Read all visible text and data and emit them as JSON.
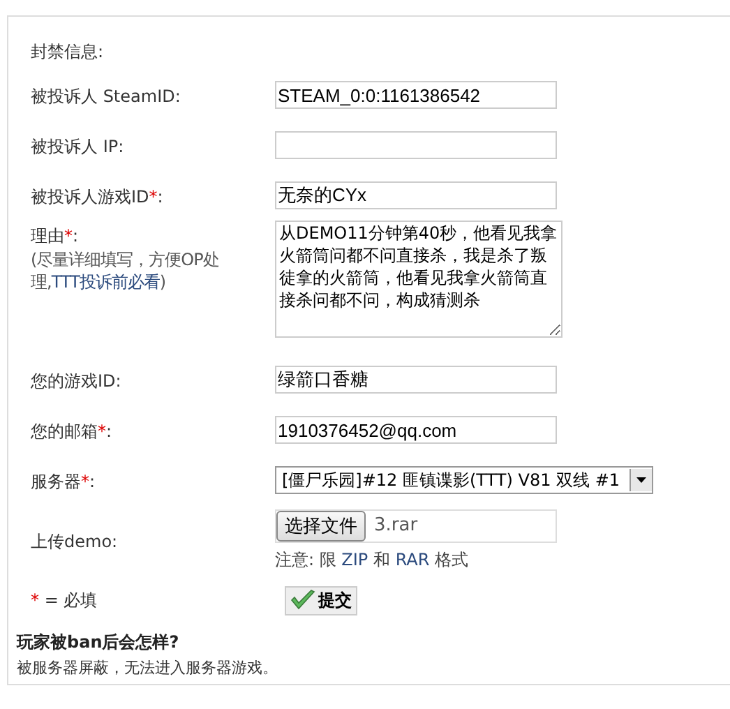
{
  "heading": "封禁信息:",
  "fields": [
    {
      "kind": "text",
      "label": "被投诉人 SteamID",
      "colon": ":",
      "value": "STEAM_0:0:1161386542"
    },
    {
      "kind": "text",
      "label": "被投诉人 IP",
      "colon": ":"
    },
    {
      "kind": "text",
      "label": "被投诉人游戏ID",
      "mark": "*",
      "colon": ":",
      "value": "无奈的CYx"
    },
    {
      "kind": "textarea",
      "label": "理由",
      "mark": "*",
      "colon": ":",
      "hint": "(尽量详细填写，方便OP处理,",
      "hint_link": "TTT投诉前必看",
      "hint_end": ")",
      "value": "从DEMO11分钟第40秒，他看见我拿火箭筒问都不问直接杀，我是杀了叛徒拿的火箭筒，他看见我拿火箭筒直接杀问都不问，构成猜测杀"
    },
    {
      "kind": "text",
      "label": "您的游戏ID",
      "colon": ":",
      "value": "绿箭口香糖"
    },
    {
      "kind": "text",
      "label": "您的邮箱",
      "mark": "*",
      "colon": ":",
      "value": "1910376452@qq.com"
    },
    {
      "kind": "select",
      "label": "服务器",
      "mark": "*",
      "colon": ":",
      "value": "[僵尸乐园]#12 匪镇谍影(TTT) V81 双线 #1"
    },
    {
      "kind": "file",
      "label": "上传demo",
      "colon": ":",
      "button": "选择文件",
      "value": "3.rar",
      "note": [
        {
          "text": "注意: 限 ",
          "highlight": false
        },
        {
          "text": "ZIP",
          "highlight": true
        },
        {
          "text": " 和 ",
          "highlight": false
        },
        {
          "text": "RAR",
          "highlight": true
        },
        {
          "text": " 格式",
          "highlight": false
        }
      ]
    }
  ],
  "legend": {
    "mark": "*",
    "text": "= 必填"
  },
  "submit": "提交",
  "faq": {
    "question": "玩家被ban后会怎样?",
    "answer": "被服务器屏蔽，无法进入服务器游戏。"
  }
}
